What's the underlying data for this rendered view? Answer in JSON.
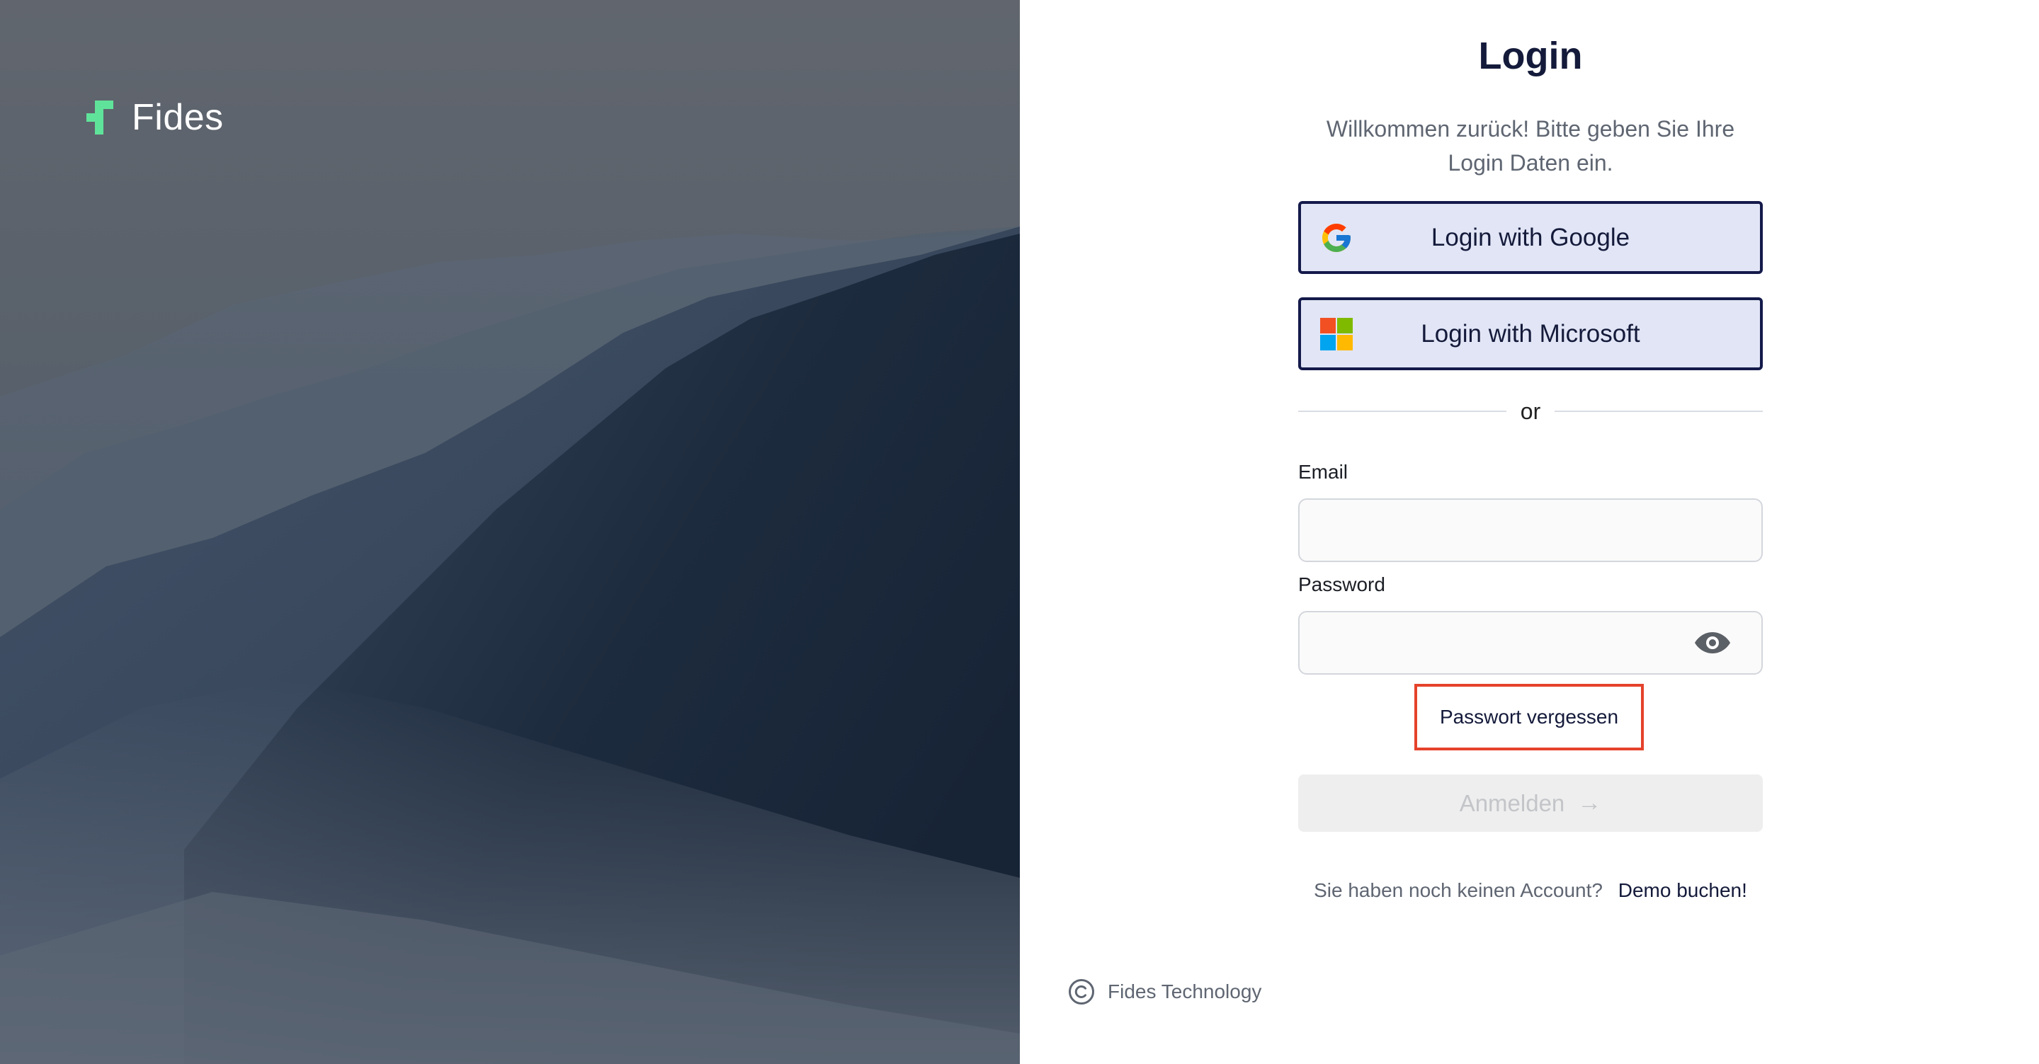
{
  "hero": {
    "brand_name": "Fides",
    "brand_color": "#5fe39a"
  },
  "login": {
    "title": "Login",
    "subtitle_line1": "Willkommen zurück! Bitte geben Sie Ihre",
    "subtitle_line2": "Login Daten ein.",
    "google_label": "Login with Google",
    "microsoft_label": "Login with Microsoft",
    "divider_text": "or",
    "email_label": "Email",
    "email_value": "",
    "password_label": "Password",
    "password_value": "",
    "forgot_password": "Passwort vergessen",
    "submit_label": "Anmelden",
    "no_account_text": "Sie haben noch keinen Account?",
    "demo_link": "Demo buchen!"
  },
  "footer": {
    "copyright_text": "Fides Technology"
  },
  "icons": {
    "brand": "fides-logo-icon",
    "google": "google-icon",
    "microsoft": "microsoft-icon",
    "password_toggle": "eye-icon",
    "submit_arrow": "arrow-right-icon",
    "copyright": "copyright-icon"
  },
  "colors": {
    "primary_navy": "#141a4a",
    "sso_button_bg": "#e1e5f5",
    "highlight_border": "#e5422b",
    "muted_text": "#5f6672"
  }
}
